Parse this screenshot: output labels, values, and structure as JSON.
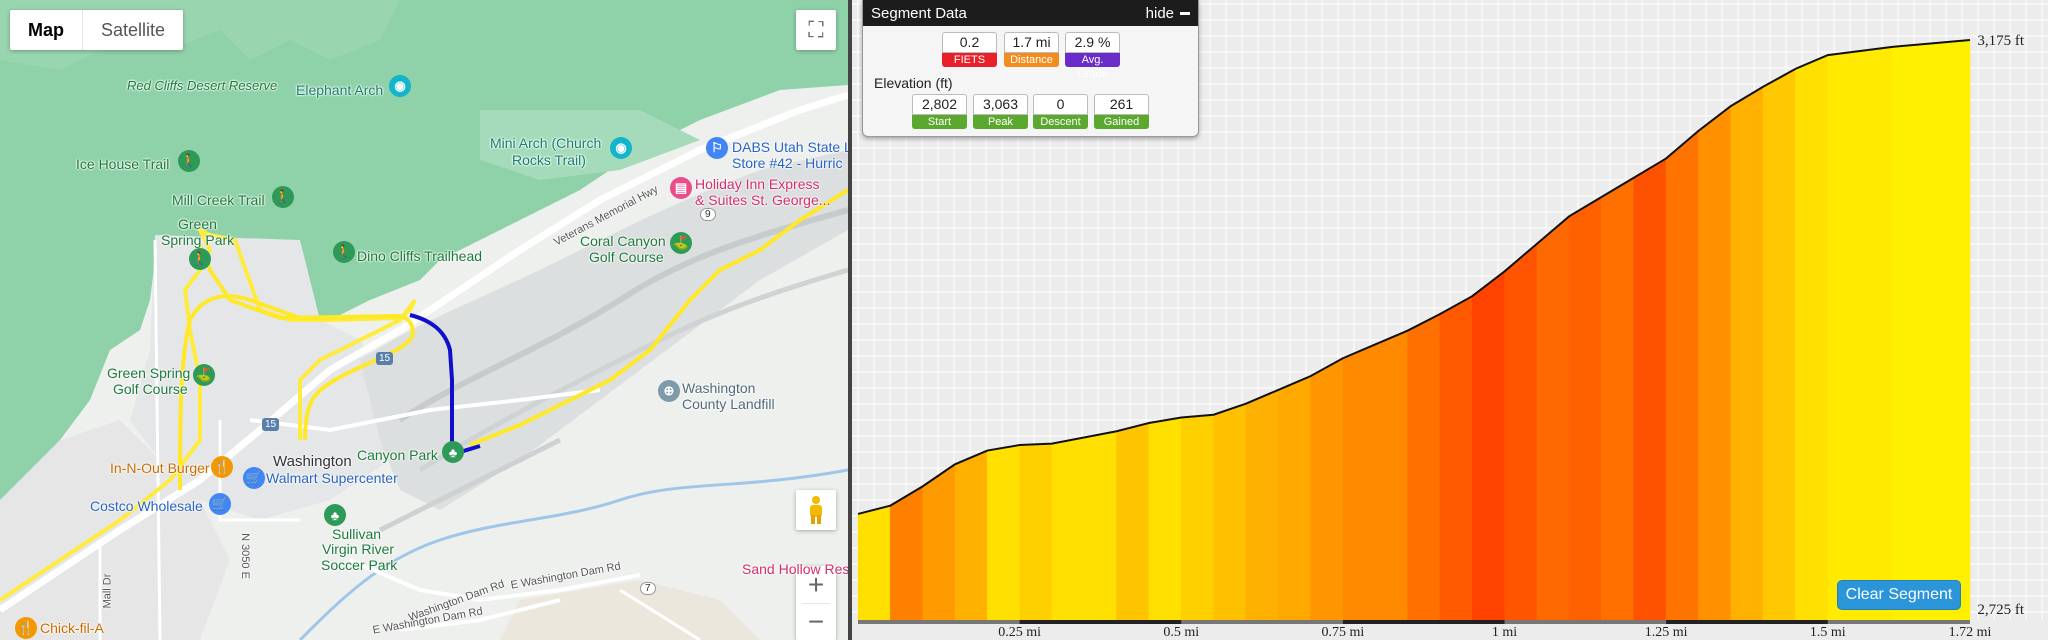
{
  "map": {
    "type_map": "Map",
    "type_satellite": "Satellite",
    "labels": {
      "red_cliffs": "Red Cliffs Desert Reserve",
      "elephant_arch": "Elephant Arch",
      "ice_house": "Ice House Trail",
      "mini_arch_1": "Mini Arch (Church",
      "mini_arch_2": "Rocks Trail)",
      "dabs_1": "DABS Utah State Li",
      "dabs_2": "Store #42 - Hurric",
      "mill_creek": "Mill Creek Trail",
      "holiday_1": "Holiday Inn Express",
      "holiday_2": "& Suites St. George...",
      "green_spring_1": "Green",
      "green_spring_2": "Spring Park",
      "veterans": "Veterans Memorial Hwy",
      "dino_cliffs": "Dino Cliffs Trailhead",
      "coral_canyon_1": "Coral Canyon",
      "coral_canyon_2": "Golf Course",
      "green_golf_1": "Green Spring",
      "green_golf_2": "Golf Course",
      "landfill_1": "Washington",
      "landfill_2": "County Landfill",
      "in_n_out": "In-N-Out Burger",
      "washington": "Washington",
      "canyon_park": "Canyon Park",
      "walmart": "Walmart Supercenter",
      "costco": "Costco Wholesale",
      "sullivan_1": "Sullivan",
      "sullivan_2": "Virgin River",
      "sullivan_3": "Soccer Park",
      "e_wash_dam_rd": "E Washington Dam Rd",
      "e_wash_dam_rd2": "E Washington Dam Rd",
      "washington_dam_rd": "Washington Dam Rd",
      "sand_hollow": "Sand Hollow Res",
      "chick_fil_a": "Chick-fil-A",
      "mall_dr": "Mall Dr",
      "n3050e": "N 3050 E",
      "i15": "15",
      "i15b": "15",
      "r9": "9",
      "r7": "7"
    }
  },
  "segment": {
    "title": "Segment Data",
    "hide_label": "hide",
    "stats": [
      {
        "value": "0.2",
        "label": "FIETS",
        "color": "#e8202a"
      },
      {
        "value": "1.7 mi",
        "label": "Distance",
        "color": "#f28c1e"
      },
      {
        "value": "2.9 %",
        "label": "Avg. Grade",
        "color": "#6a2cc8"
      }
    ],
    "elevation_title": "Elevation (ft)",
    "elevation": [
      {
        "value": "2,802",
        "label": "Start",
        "color": "#5aa82e"
      },
      {
        "value": "3,063",
        "label": "Peak",
        "color": "#5aa82e"
      },
      {
        "value": "0",
        "label": "Descent",
        "color": "#5aa82e"
      },
      {
        "value": "261",
        "label": "Gained",
        "color": "#5aa82e"
      }
    ]
  },
  "profile": {
    "y_max_label": "3,175 ft",
    "y_min_label": "2,725 ft",
    "clear_label": "Clear Segment"
  },
  "chart_data": {
    "type": "area",
    "x_unit": "mi",
    "y_unit": "ft",
    "ylim": [
      2725,
      3175
    ],
    "xlim": [
      0,
      1.72
    ],
    "x_ticks": [
      "0.25 mi",
      "0.5 mi",
      "0.75 mi",
      "1 mi",
      "1.25 mi",
      "1.5 mi",
      "1.72 mi"
    ],
    "x_tick_values": [
      0.25,
      0.5,
      0.75,
      1.0,
      1.25,
      1.5,
      1.72
    ],
    "x": [
      0,
      0.05,
      0.1,
      0.15,
      0.2,
      0.25,
      0.3,
      0.4,
      0.45,
      0.5,
      0.55,
      0.6,
      0.65,
      0.7,
      0.75,
      0.8,
      0.85,
      0.9,
      0.95,
      1.0,
      1.05,
      1.1,
      1.15,
      1.2,
      1.25,
      1.3,
      1.35,
      1.4,
      1.45,
      1.5,
      1.6,
      1.72
    ],
    "y": [
      2802,
      2808,
      2822,
      2838,
      2848,
      2852,
      2853,
      2862,
      2868,
      2872,
      2874,
      2882,
      2892,
      2902,
      2915,
      2925,
      2935,
      2947,
      2960,
      2978,
      2998,
      3018,
      3032,
      3046,
      3060,
      3080,
      3098,
      3112,
      3125,
      3135,
      3141,
      3146
    ],
    "grade_colors": [
      "#ffe000",
      "#ff8000",
      "#ff9a00",
      "#ffb000",
      "#ffe000",
      "#ffd000",
      "#ffe000",
      "#ffc400",
      "#ffe000",
      "#ffd000",
      "#ffc000",
      "#ffb000",
      "#ffa800",
      "#ff9600",
      "#ff8a00",
      "#ff8a00",
      "#ff7000",
      "#ff5a00",
      "#ff4200",
      "#ff5400",
      "#ff6a00",
      "#ff6000",
      "#ff7000",
      "#ff5200",
      "#ff7400",
      "#ff9000",
      "#ffb000",
      "#ffc800",
      "#ffe000",
      "#ffea00",
      "#fff000"
    ]
  }
}
